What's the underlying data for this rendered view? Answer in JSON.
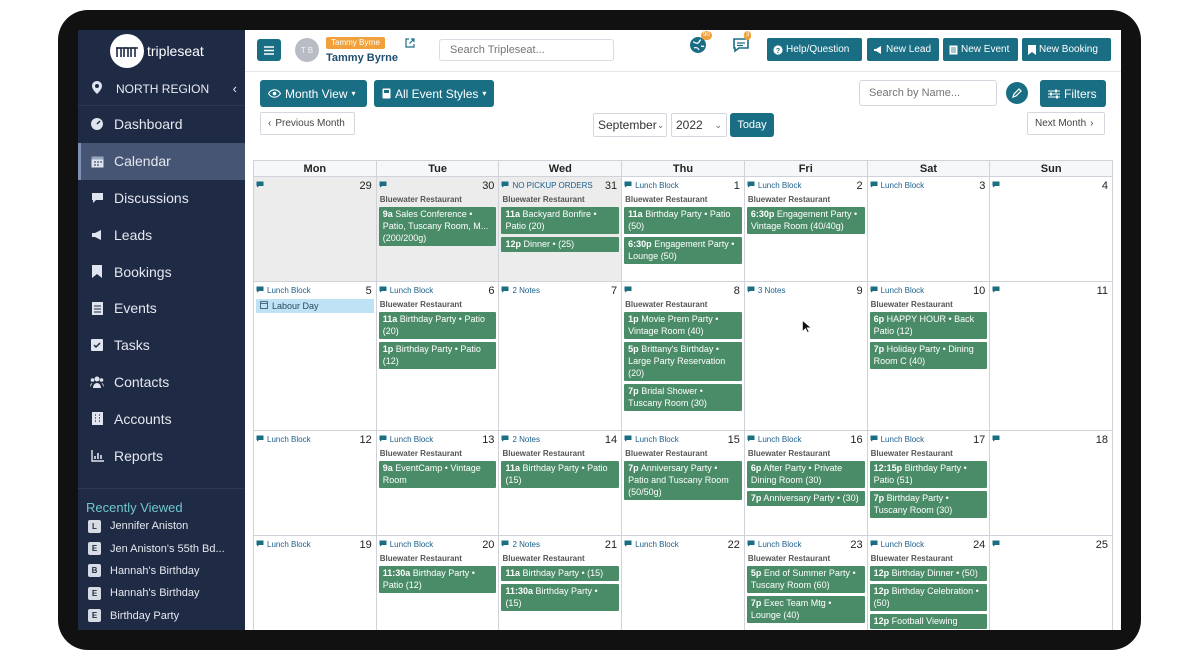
{
  "app": {
    "brand": "tripleseat"
  },
  "region": {
    "label": "NORTH REGION"
  },
  "sidebar": {
    "items": [
      {
        "label": "Dashboard",
        "icon": "dashboard-icon"
      },
      {
        "label": "Calendar",
        "icon": "calendar-icon",
        "active": true
      },
      {
        "label": "Discussions",
        "icon": "chat-icon"
      },
      {
        "label": "Leads",
        "icon": "megaphone-icon"
      },
      {
        "label": "Bookings",
        "icon": "bookmark-icon"
      },
      {
        "label": "Events",
        "icon": "document-icon"
      },
      {
        "label": "Tasks",
        "icon": "checkbox-icon"
      },
      {
        "label": "Contacts",
        "icon": "users-icon"
      },
      {
        "label": "Accounts",
        "icon": "building-icon"
      },
      {
        "label": "Reports",
        "icon": "chart-icon"
      }
    ],
    "recent_title": "Recently Viewed",
    "recent": [
      {
        "tag": "L",
        "label": "Jennifer Aniston"
      },
      {
        "tag": "E",
        "label": "Jen Aniston's 55th Bd..."
      },
      {
        "tag": "B",
        "label": "Hannah's Birthday"
      },
      {
        "tag": "E",
        "label": "Hannah's Birthday"
      },
      {
        "tag": "E",
        "label": "Birthday Party"
      }
    ]
  },
  "topbar": {
    "avatar_initials": "T B",
    "user_tag": "Tammy Byrne",
    "user_name": "Tammy Byrne",
    "search_placeholder": "Search Tripleseat...",
    "notif_count_1": "90",
    "notif_count_2": "3",
    "buttons": {
      "help": "Help/Question",
      "new_lead": "New Lead",
      "new_event": "New Event",
      "new_booking": "New Booking"
    }
  },
  "toolbar": {
    "view_label": "Month View",
    "styles_label": "All Event Styles",
    "prev_label": "Previous Month",
    "next_label": "Next Month",
    "month": "September",
    "year": "2022",
    "today_label": "Today",
    "search_placeholder": "Search by Name...",
    "filters_label": "Filters"
  },
  "calendar": {
    "days": [
      "Mon",
      "Tue",
      "Wed",
      "Thu",
      "Fri",
      "Sat",
      "Sun"
    ],
    "weeks": [
      {
        "height": 105,
        "cells": [
          {
            "num": "29",
            "label": "",
            "grey": true,
            "events": []
          },
          {
            "num": "30",
            "label": "",
            "grey": true,
            "venue": "Bluewater Restaurant",
            "events": [
              {
                "time": "9a",
                "text": "Sales Conference • Patio, Tuscany Room, M... (200/200g)"
              }
            ]
          },
          {
            "num": "31",
            "label": "NO PICKUP ORDERS",
            "grey": true,
            "venue": "Bluewater Restaurant",
            "events": [
              {
                "time": "11a",
                "text": "Backyard Bonfire • Patio (20)"
              },
              {
                "time": "12p",
                "text": "Dinner • (25)"
              }
            ]
          },
          {
            "num": "1",
            "label": "Lunch Block",
            "venue": "Bluewater Restaurant",
            "events": [
              {
                "time": "11a",
                "text": "Birthday Party • Patio (50)"
              },
              {
                "time": "6:30p",
                "text": "Engagement Party • Lounge (50)"
              }
            ]
          },
          {
            "num": "2",
            "label": "Lunch Block",
            "venue": "Bluewater Restaurant",
            "events": [
              {
                "time": "6:30p",
                "text": "Engagement Party • Vintage Room (40/40g)"
              }
            ]
          },
          {
            "num": "3",
            "label": "Lunch Block",
            "events": []
          },
          {
            "num": "4",
            "label": "",
            "events": []
          }
        ]
      },
      {
        "height": 149,
        "cells": [
          {
            "num": "5",
            "label": "Lunch Block",
            "holiday": "Labour Day",
            "events": []
          },
          {
            "num": "6",
            "label": "Lunch Block",
            "venue": "Bluewater Restaurant",
            "events": [
              {
                "time": "11a",
                "text": "Birthday Party • Patio (20)"
              },
              {
                "time": "1p",
                "text": "Birthday Party • Patio (12)"
              }
            ]
          },
          {
            "num": "7",
            "label": "2 Notes",
            "events": []
          },
          {
            "num": "8",
            "label": "",
            "venue": "Bluewater Restaurant",
            "events": [
              {
                "time": "1p",
                "text": "Movie Prem Party • Vintage Room (40)"
              },
              {
                "time": "5p",
                "text": "Brittany's Birthday • Large Party Reservation (20)"
              },
              {
                "time": "7p",
                "text": "Bridal Shower • Tuscany Room (30)"
              }
            ]
          },
          {
            "num": "9",
            "label": "3 Notes",
            "events": []
          },
          {
            "num": "10",
            "label": "Lunch Block",
            "venue": "Bluewater Restaurant",
            "events": [
              {
                "time": "6p",
                "text": "HAPPY HOUR • Back Patio (12)"
              },
              {
                "time": "7p",
                "text": "Holiday Party • Dining Room C (40)"
              }
            ]
          },
          {
            "num": "11",
            "label": "",
            "events": []
          }
        ]
      },
      {
        "height": 105,
        "cells": [
          {
            "num": "12",
            "label": "Lunch Block",
            "events": []
          },
          {
            "num": "13",
            "label": "Lunch Block",
            "venue": "Bluewater Restaurant",
            "events": [
              {
                "time": "9a",
                "text": "EventCamp • Vintage Room"
              }
            ]
          },
          {
            "num": "14",
            "label": "2 Notes",
            "venue": "Bluewater Restaurant",
            "events": [
              {
                "time": "11a",
                "text": "Birthday Party • Patio (15)"
              }
            ]
          },
          {
            "num": "15",
            "label": "Lunch Block",
            "venue": "Bluewater Restaurant",
            "events": [
              {
                "time": "7p",
                "text": "Anniversary Party • Patio and Tuscany Room (50/50g)"
              }
            ]
          },
          {
            "num": "16",
            "label": "Lunch Block",
            "venue": "Bluewater Restaurant",
            "events": [
              {
                "time": "6p",
                "text": "After Party • Private Dining Room (30)"
              },
              {
                "time": "7p",
                "text": "Anniversary Party • (30)"
              }
            ]
          },
          {
            "num": "17",
            "label": "Lunch Block",
            "venue": "Bluewater Restaurant",
            "events": [
              {
                "time": "12:15p",
                "text": "Birthday Party • Patio (51)"
              },
              {
                "time": "7p",
                "text": "Birthday Party • Tuscany Room (30)"
              }
            ]
          },
          {
            "num": "18",
            "label": "",
            "events": []
          }
        ]
      },
      {
        "height": 110,
        "cells": [
          {
            "num": "19",
            "label": "Lunch Block",
            "events": []
          },
          {
            "num": "20",
            "label": "Lunch Block",
            "venue": "Bluewater Restaurant",
            "events": [
              {
                "time": "11:30a",
                "text": "Birthday Party • Patio (12)"
              }
            ]
          },
          {
            "num": "21",
            "label": "2 Notes",
            "venue": "Bluewater Restaurant",
            "events": [
              {
                "time": "11a",
                "text": "Birthday Party • (15)"
              },
              {
                "time": "11:30a",
                "text": "Birthday Party • (15)"
              }
            ]
          },
          {
            "num": "22",
            "label": "Lunch Block",
            "events": []
          },
          {
            "num": "23",
            "label": "Lunch Block",
            "venue": "Bluewater Restaurant",
            "events": [
              {
                "time": "5p",
                "text": "End of Summer Party • Tuscany Room (60)"
              },
              {
                "time": "7p",
                "text": "Exec Team Mtg • Lounge (40)"
              }
            ]
          },
          {
            "num": "24",
            "label": "Lunch Block",
            "venue": "Bluewater Restaurant",
            "events": [
              {
                "time": "12p",
                "text": "Birthday Dinner • (50)"
              },
              {
                "time": "12p",
                "text": "Birthday Celebration • (50)"
              },
              {
                "time": "12p",
                "text": "Football Viewing"
              }
            ]
          },
          {
            "num": "25",
            "label": "",
            "events": []
          }
        ]
      }
    ]
  },
  "colors": {
    "sidebar": "#1f2a44",
    "accent": "#1a6e84",
    "event": "#4b8c68",
    "badge": "#f0a13c"
  }
}
